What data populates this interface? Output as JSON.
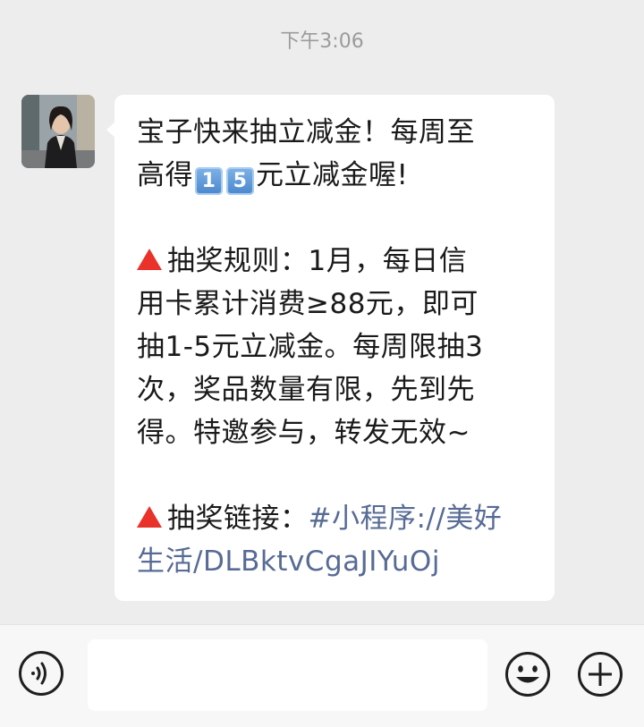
{
  "timestamp": "下午3:06",
  "message": {
    "line1": "宝子快来抽立减金！每周至",
    "line2_prefix": "高得",
    "line2_digit1": "1",
    "line2_digit2": "5",
    "line2_suffix": "元立减金喔!",
    "rules_line1": "抽奖规则：1月，每日信",
    "rules_line2": "用卡累计消费≥88元，即可",
    "rules_line3": "抽1-5元立减金。每周限抽3",
    "rules_line4": "次，奖品数量有限，先到先",
    "rules_line5": "得。特邀参与，转发无效~",
    "link_label": "抽奖链接：",
    "link_part1": "#小程序://美好",
    "link_part2": "生活/DLBktvCgaJIYuOj"
  },
  "icons": {
    "warning": "red-triangle-icon",
    "voice": "voice-icon",
    "emoji": "emoji-icon",
    "plus": "plus-icon"
  },
  "colors": {
    "background": "#ededed",
    "bubble": "#ffffff",
    "link": "#576b95",
    "triangle": "#e8322a",
    "number_emoji": "#4a86cc"
  }
}
